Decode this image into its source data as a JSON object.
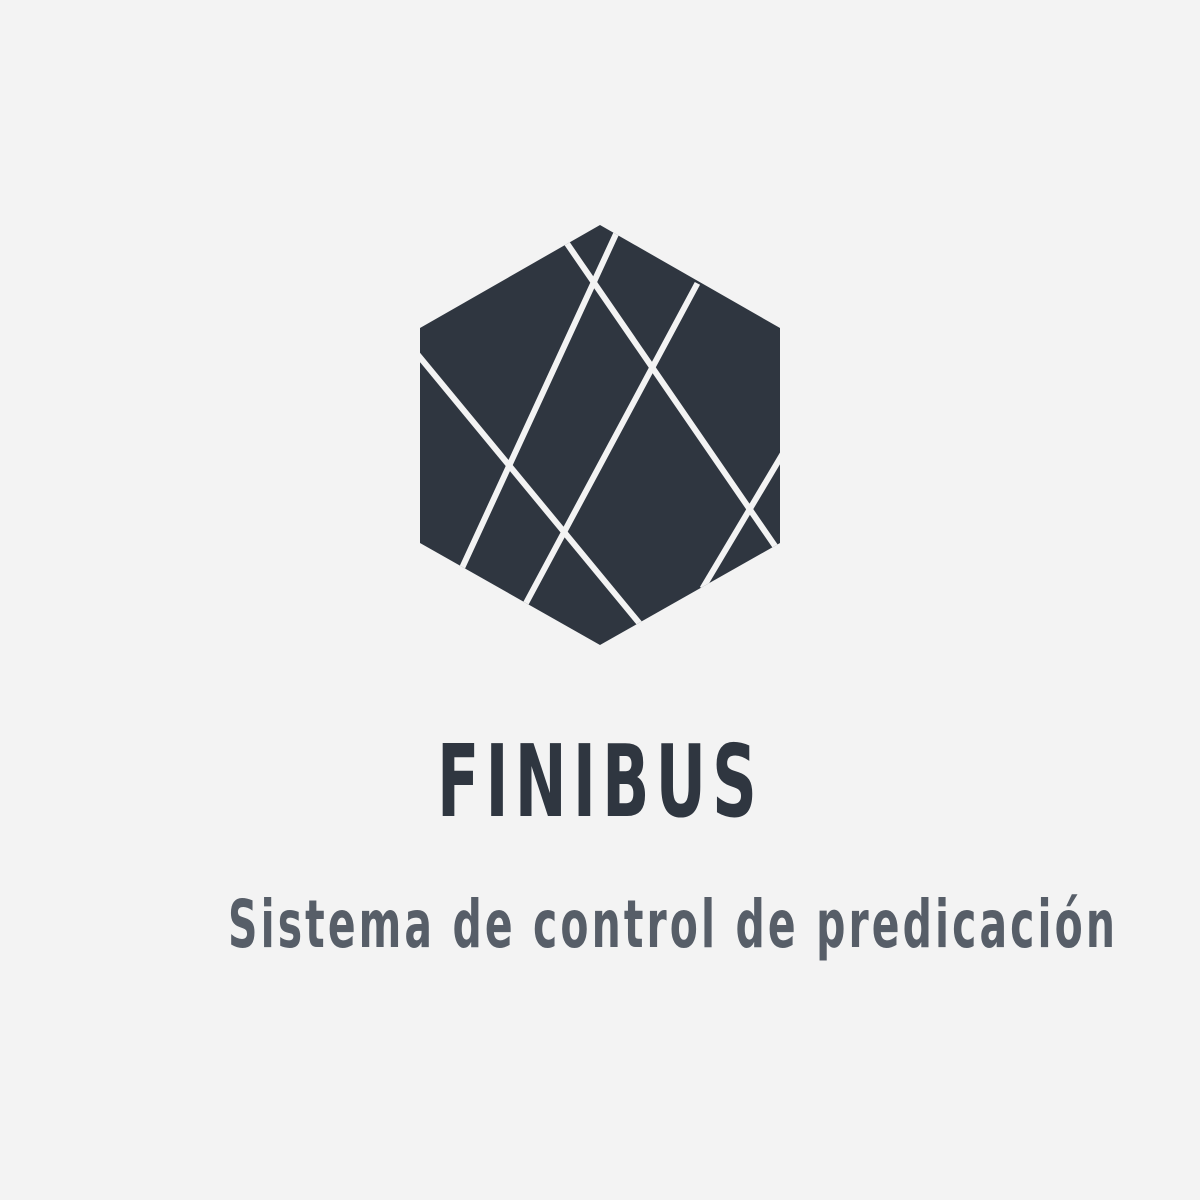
{
  "logo": {
    "icon": "faceted-hexagon-icon",
    "fill_color": "#2f3640",
    "line_color": "#f3f3f3"
  },
  "brand": {
    "name": "FINIBUS",
    "tagline": "Sistema de control de predicación",
    "name_color": "#2f3640",
    "tagline_color": "#575e68"
  },
  "page": {
    "background": "#f3f3f3"
  }
}
